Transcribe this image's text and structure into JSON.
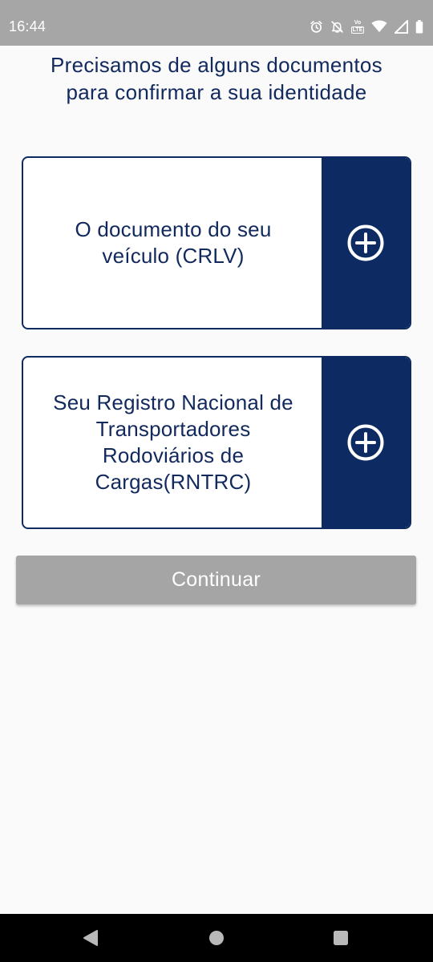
{
  "status_bar": {
    "time": "16:44",
    "volte_top": "Vo",
    "volte_bottom": "LTE",
    "icons": [
      "alarm-icon",
      "bell-off-icon",
      "volte-icon",
      "wifi-icon",
      "signal-icon",
      "battery-icon"
    ]
  },
  "title_line1": "Precisamos de alguns documentos",
  "title_line2": "para confirmar a sua identidade",
  "documents": [
    {
      "line1": "O documento do seu",
      "line2": "veículo (CRLV)",
      "icon": "add-circle-icon"
    },
    {
      "line1": "Seu Registro Nacional de",
      "line2": "Transportadores",
      "line3": "Rodoviários de",
      "line4": "Cargas(RNTRC)",
      "icon": "add-circle-icon"
    }
  ],
  "continue_label": "Continuar",
  "navigation": {
    "icons": [
      "back-icon",
      "home-icon",
      "recents-icon"
    ]
  },
  "colors": {
    "primary": "#0d2b62",
    "title_text": "#12295d",
    "disabled_button": "#a5a5a5",
    "status_bar": "#a6a6a6",
    "background": "#fafafa"
  }
}
